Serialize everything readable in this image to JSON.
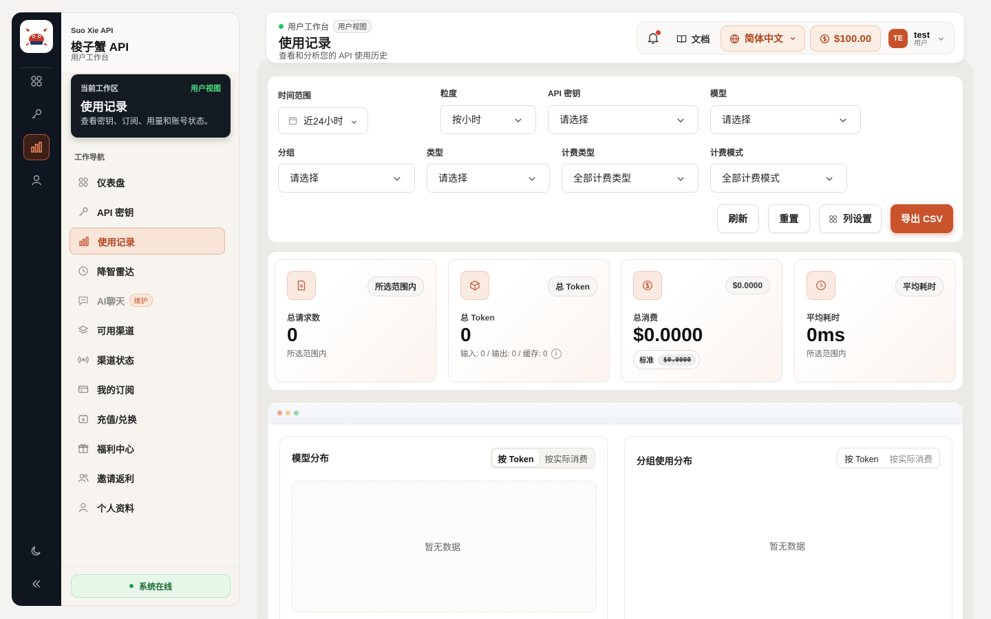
{
  "brand": {
    "subtitle": "Suo Xie API",
    "name": "梭子蟹 API",
    "workspace": "用户工作台"
  },
  "workspace_card": {
    "label": "当前工作区",
    "tag": "用户视图",
    "title": "使用记录",
    "desc": "查看密钥、订阅、用量和账号状态。"
  },
  "nav": {
    "title": "工作导航",
    "items": [
      {
        "label": "仪表盘",
        "icon": "grid-icon"
      },
      {
        "label": "API 密钥",
        "icon": "key-icon"
      },
      {
        "label": "使用记录",
        "icon": "bar-chart-icon",
        "active": true
      },
      {
        "label": "降智雷达",
        "icon": "clock-icon"
      },
      {
        "label": "AI聊天",
        "icon": "chat-icon",
        "badge": "维护"
      },
      {
        "label": "可用渠道",
        "icon": "layers-icon"
      },
      {
        "label": "渠道状态",
        "icon": "signal-icon"
      },
      {
        "label": "我的订阅",
        "icon": "card-icon"
      },
      {
        "label": "充值/兑换",
        "icon": "wallet-icon"
      },
      {
        "label": "福利中心",
        "icon": "gift-icon"
      },
      {
        "label": "邀请返利",
        "icon": "users-icon"
      },
      {
        "label": "个人资料",
        "icon": "user-icon"
      }
    ]
  },
  "status": "系统在线",
  "header": {
    "crumb": "用户工作台",
    "crumb_tag": "用户视图",
    "title": "使用记录",
    "subtitle": "查看和分析您的 API 使用历史",
    "docs": "文档",
    "language": "简体中文",
    "balance": "$100.00",
    "avatar": "TE",
    "user_name": "test",
    "user_role": "用户"
  },
  "filters": {
    "time_range": {
      "label": "时间范围",
      "value": "近24小时"
    },
    "granularity": {
      "label": "粒度",
      "value": "按小时"
    },
    "api_key": {
      "label": "API 密钥",
      "value": "请选择"
    },
    "model": {
      "label": "模型",
      "value": "请选择"
    },
    "group": {
      "label": "分组",
      "value": "请选择"
    },
    "type": {
      "label": "类型",
      "value": "请选择"
    },
    "billing_type": {
      "label": "计费类型",
      "value": "全部计费类型"
    },
    "billing_mode": {
      "label": "计费模式",
      "value": "全部计费模式"
    },
    "buttons": {
      "refresh": "刷新",
      "reset": "重置",
      "columns": "列设置",
      "export": "导出 CSV"
    }
  },
  "stats": [
    {
      "icon": "document-icon",
      "pill": "所选范围内",
      "label": "总请求数",
      "value": "0",
      "foot": "所选范围内"
    },
    {
      "icon": "cube-icon",
      "pill": "总 Token",
      "label": "总 Token",
      "value": "0",
      "foot": "输入: 0 / 输出: 0 / 缓存: 0"
    },
    {
      "icon": "dollar-icon",
      "pill": "$0.0000",
      "label": "总消费",
      "value": "$0.0000",
      "std_label": "标准",
      "std_value": "$0.0000"
    },
    {
      "icon": "clock-icon",
      "pill": "平均耗时",
      "label": "平均耗时",
      "value": "0ms",
      "foot": "所选范围内"
    }
  ],
  "charts": {
    "model": {
      "title": "模型分布",
      "toggle": [
        "按 Token",
        "按实际消费"
      ],
      "empty": "暂无数据"
    },
    "group": {
      "title": "分组使用分布",
      "toggle": [
        "按 Token",
        "按实际消费"
      ],
      "empty": "暂无数据"
    }
  },
  "colors": {
    "accent": "#c9532b",
    "dark": "#0f1620",
    "online": "#22a34a"
  }
}
